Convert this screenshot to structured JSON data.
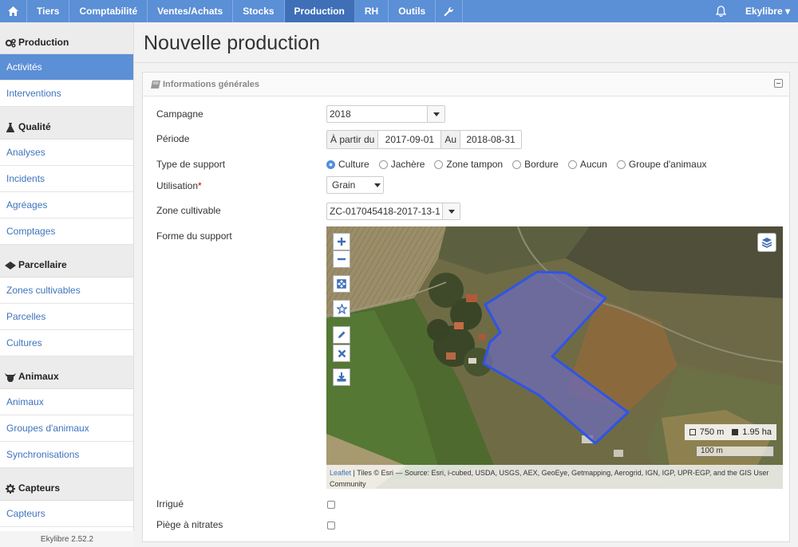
{
  "nav": {
    "items": [
      "Tiers",
      "Comptabilité",
      "Ventes/Achats",
      "Stocks",
      "Production",
      "RH",
      "Outils"
    ],
    "active": "Production",
    "user": "Ekylibre ▾"
  },
  "sidebar": {
    "groups": [
      {
        "title": "Production",
        "icon": "gears-icon",
        "items": [
          "Activités",
          "Interventions"
        ]
      },
      {
        "title": "Qualité",
        "icon": "flask-icon",
        "items": [
          "Analyses",
          "Incidents",
          "Agréages",
          "Comptages"
        ]
      },
      {
        "title": "Parcellaire",
        "icon": "land-icon",
        "items": [
          "Zones cultivables",
          "Parcelles",
          "Cultures"
        ]
      },
      {
        "title": "Animaux",
        "icon": "cow-icon",
        "items": [
          "Animaux",
          "Groupes d'animaux",
          "Synchronisations"
        ]
      },
      {
        "title": "Capteurs",
        "icon": "gear-icon",
        "items": [
          "Capteurs"
        ]
      }
    ],
    "active_item": "Activités",
    "version": "Ekylibre 2.52.2"
  },
  "page": {
    "title": "Nouvelle production"
  },
  "panel": {
    "title": "Informations générales",
    "fields": {
      "campaign": {
        "label": "Campagne",
        "value": "2018"
      },
      "period": {
        "label": "Période",
        "from_label": "À partir du",
        "from": "2017-09-01",
        "to_label": "Au",
        "to": "2018-08-31"
      },
      "support_type": {
        "label": "Type de support",
        "options": [
          "Culture",
          "Jachère",
          "Zone tampon",
          "Bordure",
          "Aucun",
          "Groupe d'animaux"
        ],
        "selected": "Culture"
      },
      "usage": {
        "label": "Utilisation",
        "required_mark": "*",
        "value": "Grain"
      },
      "zone": {
        "label": "Zone cultivable",
        "value": "ZC-017045418-2017-13-1"
      },
      "shape": {
        "label": "Forme du support"
      },
      "irrigated": {
        "label": "Irrigué",
        "checked": false
      },
      "nitrate_trap": {
        "label": "Piège à nitrates",
        "checked": false
      }
    }
  },
  "map": {
    "perimeter": "750 m",
    "area": "1.95 ha",
    "scale": "100 m",
    "attribution_link": "Leaflet",
    "attribution_text": " | Tiles © Esri — Source: Esri, i-cubed, USDA, USGS, AEX, GeoEye, Getmapping, Aerogrid, IGN, IGP, UPR-EGP, and the GIS User Community",
    "shape_color": "#2f55e6"
  }
}
